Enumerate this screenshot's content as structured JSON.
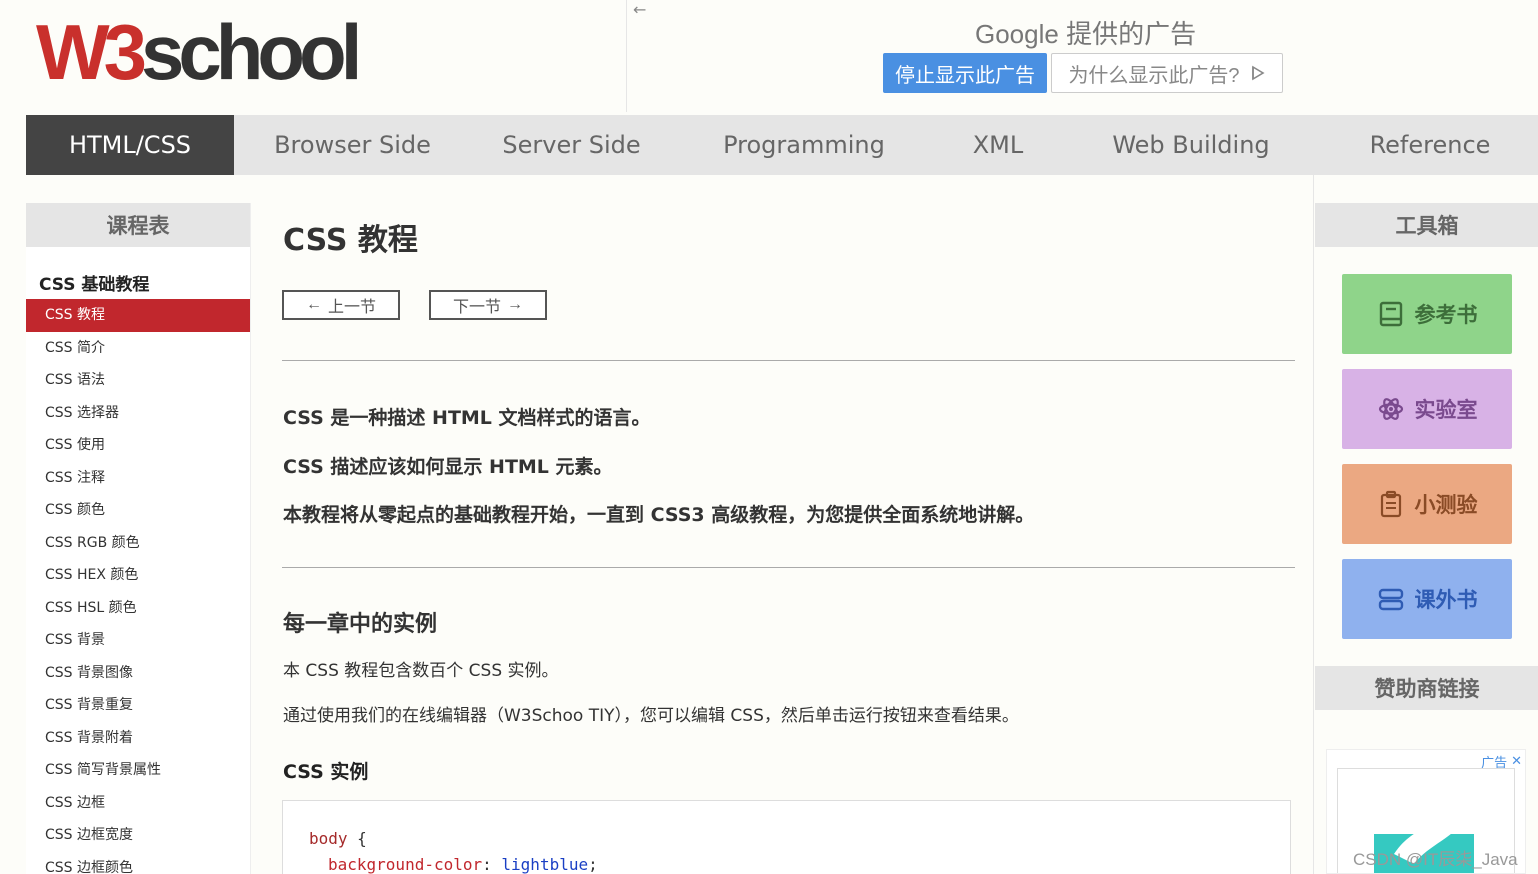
{
  "header": {
    "logo_w3": "W3",
    "logo_school": "school",
    "ad_back": "←",
    "google_label": "Google 提供的广告",
    "ad_stop": "停止显示此广告",
    "ad_why": "为什么显示此广告?"
  },
  "nav": {
    "items": [
      {
        "label": "HTML/CSS",
        "active": true
      },
      {
        "label": "Browser Side"
      },
      {
        "label": "Server Side"
      },
      {
        "label": "Programming"
      },
      {
        "label": "XML"
      },
      {
        "label": "Web Building"
      },
      {
        "label": "Reference"
      }
    ]
  },
  "left_sidebar": {
    "title": "课程表",
    "group_title": "CSS 基础教程",
    "items": [
      "CSS 教程",
      "CSS 简介",
      "CSS 语法",
      "CSS 选择器",
      "CSS 使用",
      "CSS 注释",
      "CSS 颜色",
      "CSS RGB 颜色",
      "CSS HEX 颜色",
      "CSS HSL 颜色",
      "CSS 背景",
      "CSS 背景图像",
      "CSS 背景重复",
      "CSS 背景附着",
      "CSS 简写背景属性",
      "CSS 边框",
      "CSS 边框宽度",
      "CSS 边框颜色"
    ],
    "active_index": 0
  },
  "main": {
    "title": "CSS 教程",
    "prev": "上一节",
    "next": "下一节",
    "lead1": "CSS 是一种描述 HTML 文档样式的语言。",
    "lead2": "CSS 描述应该如何显示 HTML 元素。",
    "lead3": "本教程将从零起点的基础教程开始，一直到 CSS3 高级教程，为您提供全面系统地讲解。",
    "section_title": "每一章中的实例",
    "para1": "本 CSS 教程包含数百个 CSS 实例。",
    "para2": "通过使用我们的在线编辑器（W3Schoo TIY），您可以编辑 CSS，然后单击运行按钮来查看结果。",
    "example_title": "CSS 实例",
    "code": {
      "selector": "body",
      "open_brace": "{",
      "prop": "background-color",
      "colon": ":",
      "value": "lightblue",
      "semicolon": ";"
    }
  },
  "right_sidebar": {
    "title": "工具箱",
    "tools": {
      "ref": "参考书",
      "lab": "实验室",
      "quiz": "小测验",
      "book": "课外书"
    },
    "sponsor_title": "赞助商链接",
    "ad_tag": "广告"
  },
  "watermark": "CSDN @IT辰柒_Java",
  "colors": {
    "brand_red": "#c1272d",
    "nav_active": "#444444",
    "ad_blue": "#4a90e2"
  }
}
